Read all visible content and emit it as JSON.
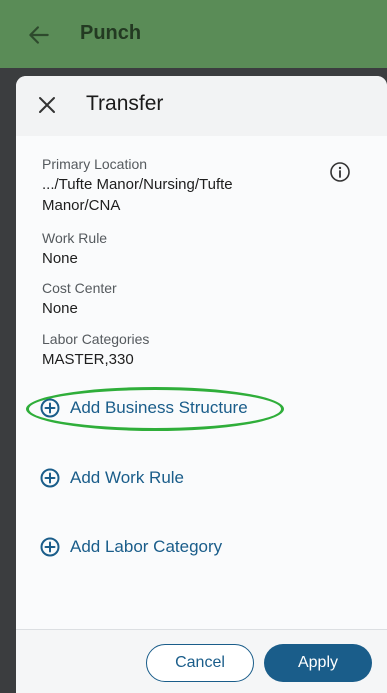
{
  "appbar": {
    "title": "Punch",
    "back_icon": "arrow-left-icon"
  },
  "panel": {
    "title": "Transfer",
    "close_icon": "close-icon",
    "info_icon": "info-icon"
  },
  "fields": {
    "primary_location": {
      "label": "Primary Location",
      "value": ".../Tufte Manor/Nursing/Tufte Manor/CNA"
    },
    "work_rule": {
      "label": "Work Rule",
      "value": "None"
    },
    "cost_center": {
      "label": "Cost Center",
      "value": "None"
    },
    "labor_categories": {
      "label": "Labor Categories",
      "value": "MASTER,330"
    }
  },
  "actions": {
    "add_business_structure": "Add Business Structure",
    "add_work_rule": "Add Work Rule",
    "add_labor_category": "Add Labor Category"
  },
  "footer": {
    "cancel_label": "Cancel",
    "apply_label": "Apply"
  },
  "colors": {
    "appbar": "#5a8c57",
    "accent": "#1a5d8a",
    "highlight": "#2fae3a"
  }
}
